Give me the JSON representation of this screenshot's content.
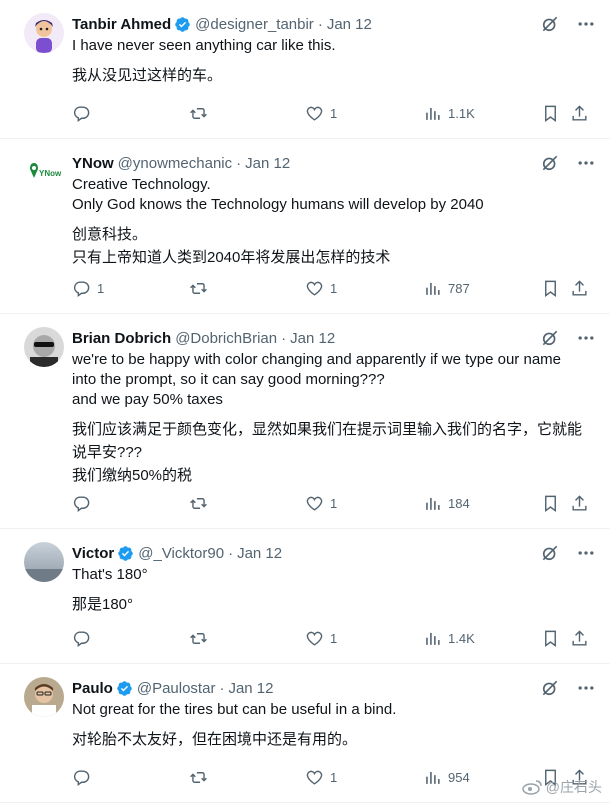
{
  "tweets": [
    {
      "name": "Tanbir Ahmed",
      "verified": true,
      "handle": "@designer_tanbir",
      "date": "Jan 12",
      "lines": [
        "I have never seen anything car like this."
      ],
      "translation": [
        "我从没见过这样的车。"
      ],
      "replies": "",
      "retweets": "",
      "likes": "1",
      "views": "1.1K"
    },
    {
      "name": "YNow",
      "verified": false,
      "handle": "@ynowmechanic",
      "date": "Jan 12",
      "lines": [
        "Creative Technology.",
        "Only God knows the Technology humans will develop by 2040"
      ],
      "translation": [
        "创意科技。",
        "只有上帝知道人类到2040年将发展出怎样的技术"
      ],
      "replies": "1",
      "retweets": "",
      "likes": "1",
      "views": "787"
    },
    {
      "name": "Brian Dobrich",
      "verified": false,
      "handle": "@DobrichBrian",
      "date": "Jan 12",
      "lines": [
        "we're to be happy with color changing and apparently if we type our name",
        "into the prompt, so it can say good morning???",
        "and we pay 50% taxes"
      ],
      "translation": [
        "我们应该满足于颜色变化，显然如果我们在提示词里输入我们的名字，它就能",
        "说早安???",
        "我们缴纳50%的税"
      ],
      "replies": "",
      "retweets": "",
      "likes": "1",
      "views": "184"
    },
    {
      "name": "Victor",
      "verified": true,
      "handle": "@_Vicktor90",
      "date": "Jan 12",
      "lines": [
        "That's 180°"
      ],
      "translation": [
        "那是180°"
      ],
      "replies": "",
      "retweets": "",
      "likes": "1",
      "views": "1.4K"
    },
    {
      "name": "Paulo",
      "verified": true,
      "handle": "@Paulostar",
      "date": "Jan 12",
      "lines": [
        "Not great for the tires but can be useful in a bind."
      ],
      "translation": [
        "对轮胎不太友好，但在困境中还是有用的。"
      ],
      "replies": "",
      "retweets": "",
      "likes": "1",
      "views": "954"
    }
  ],
  "ynow_logo_text": "YNow",
  "watermark": "@庄石头",
  "colors": {
    "verified": "#1d9bf0",
    "text": "#0f1419",
    "secondary": "#536471",
    "divider": "#eff3f4"
  },
  "icons": [
    "grok-icon",
    "more-icon",
    "reply-icon",
    "retweet-icon",
    "like-icon",
    "views-icon",
    "bookmark-icon",
    "share-icon"
  ]
}
